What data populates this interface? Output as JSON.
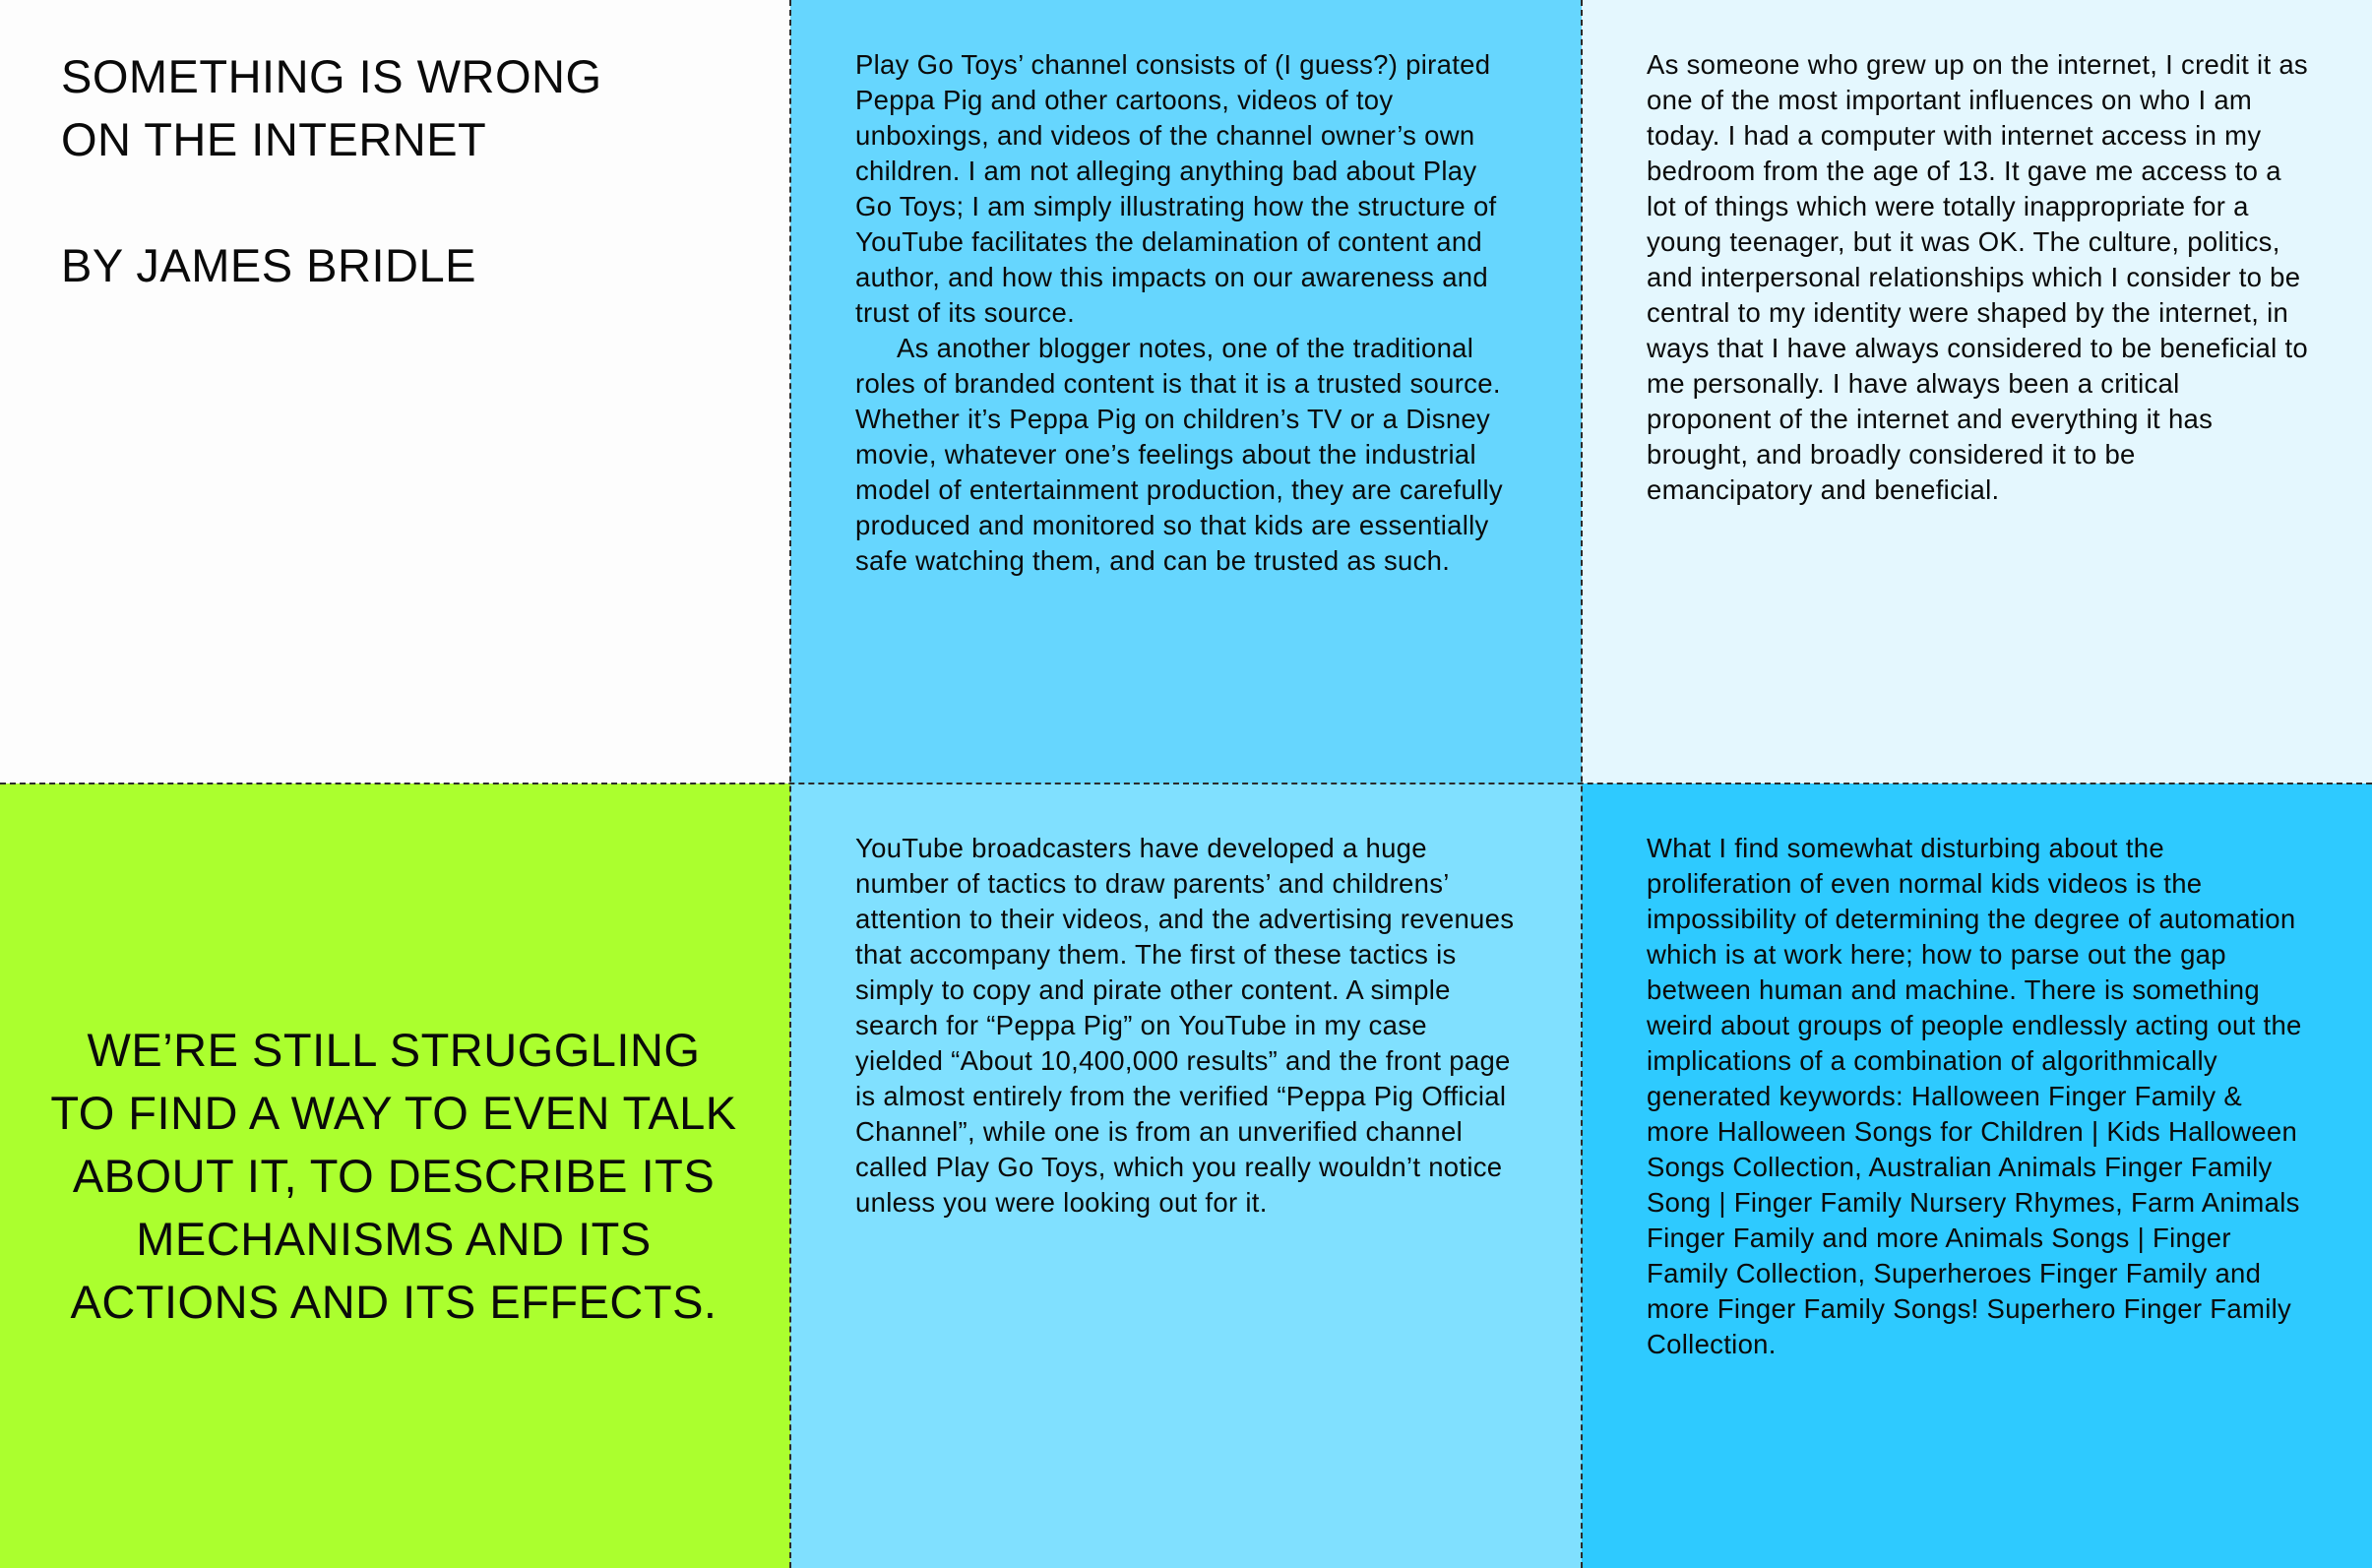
{
  "colors": {
    "title_panel": "#fdfdfd",
    "panel_top_middle": "#66d6fe",
    "panel_top_right": "#e4f7fe",
    "panel_bottom_left": "#abff2e",
    "panel_bottom_middle": "#80e0ff",
    "panel_bottom_right": "#2ecaff",
    "divider": "#2b2b2b",
    "text": "#0a0a0a"
  },
  "title_panel": {
    "title_line_1": "SOMETHING IS WRONG",
    "title_line_2": "ON THE INTERNET",
    "byline": "BY JAMES BRIDLE"
  },
  "panel_top_middle": {
    "paragraph_1": "Play Go Toys’ channel consists of (I guess?) pirated Peppa Pig and other cartoons, videos of toy unboxings, and videos of the channel owner’s own children. I am not alleging anything bad about Play Go Toys; I am simply illustrating how the structure of YouTube facilitates the delamination of content and author, and how this impacts on our awareness and trust of its source.",
    "paragraph_2": "As another blogger notes, one of the traditional roles of branded content is that it is a trusted source. Whether it’s Peppa Pig on children’s TV or a Disney movie, whatever one’s feelings about the industrial model of entertainment production, they are carefully produced and monitored so that kids are essentially safe watching them, and can be trusted as such."
  },
  "panel_top_right": {
    "paragraph_1": "As someone who grew up on the internet, I credit it as one of the most important influences on who I am today. I had a computer with internet access in my bedroom from the age of 13. It gave me access to a lot of things which were totally inappropriate for a young teenager, but it was OK. The culture, politics, and interpersonal relationships which I consider to be central to my identity were shaped by the internet, in ways that I have always considered to be beneficial to me personally. I have always been a critical proponent of the internet and everything it has brought, and broadly considered it to be emancipatory and beneficial."
  },
  "panel_bottom_left": {
    "pull_quote": "WE’RE STILL STRUGGLING TO FIND A WAY TO EVEN TALK ABOUT IT, TO DESCRIBE ITS MECHANISMS AND ITS ACTIONS AND ITS EFFECTS."
  },
  "panel_bottom_middle": {
    "paragraph_1": "YouTube broadcasters have developed a huge number of tactics to draw parents’ and childrens’ attention to their videos, and the advertising revenues that accompany them. The first of these tactics is simply to copy and pirate other content. A simple search for “Peppa Pig” on YouTube in my case yielded “About 10,400,000 results” and the front page is almost entirely from the verified “Peppa Pig Official Channel”, while one is from an unverified channel called Play Go Toys, which you really wouldn’t notice unless you were looking out for it."
  },
  "panel_bottom_right": {
    "paragraph_1": "What I find somewhat disturbing about the proliferation of even normal kids videos is the impossibility of determining the degree of automation which is at work here; how to parse out the gap between human and machine. There is something weird about groups of people endlessly acting out the implications of a combination of algorithmically generated keywords: Halloween Finger Family & more Halloween Songs for Children | Kids Halloween Songs Collection, Australian Animals Finger Family Song | Finger Family Nursery Rhymes, Farm Animals Finger Family and more Animals Songs | Finger Family Collection, Superheroes Finger Family and more Finger Family Songs! Superhero Finger Family Collection."
  }
}
